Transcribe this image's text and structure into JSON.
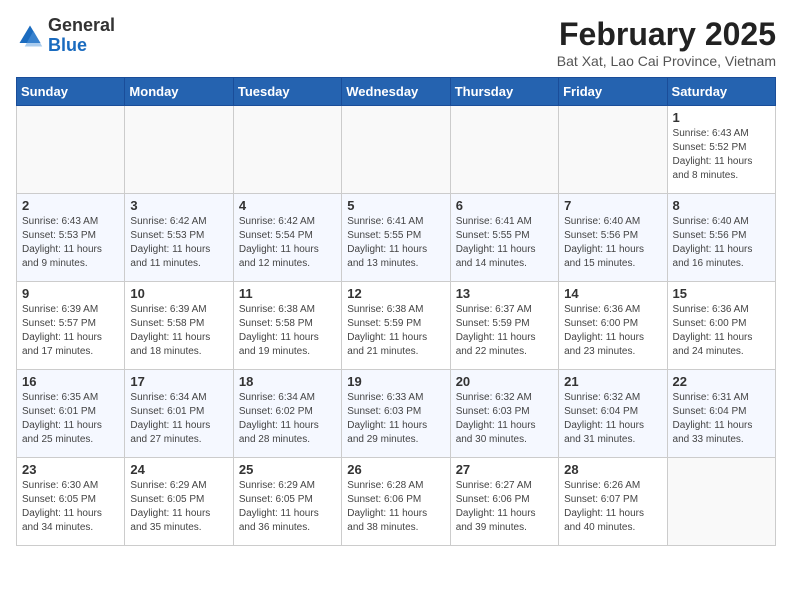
{
  "logo": {
    "general": "General",
    "blue": "Blue"
  },
  "title": "February 2025",
  "subtitle": "Bat Xat, Lao Cai Province, Vietnam",
  "days_of_week": [
    "Sunday",
    "Monday",
    "Tuesday",
    "Wednesday",
    "Thursday",
    "Friday",
    "Saturday"
  ],
  "weeks": [
    [
      {
        "day": null
      },
      {
        "day": null
      },
      {
        "day": null
      },
      {
        "day": null
      },
      {
        "day": null
      },
      {
        "day": null
      },
      {
        "day": "1",
        "info": "Sunrise: 6:43 AM\nSunset: 5:52 PM\nDaylight: 11 hours and 8 minutes."
      }
    ],
    [
      {
        "day": "2",
        "info": "Sunrise: 6:43 AM\nSunset: 5:53 PM\nDaylight: 11 hours and 9 minutes."
      },
      {
        "day": "3",
        "info": "Sunrise: 6:42 AM\nSunset: 5:53 PM\nDaylight: 11 hours and 11 minutes."
      },
      {
        "day": "4",
        "info": "Sunrise: 6:42 AM\nSunset: 5:54 PM\nDaylight: 11 hours and 12 minutes."
      },
      {
        "day": "5",
        "info": "Sunrise: 6:41 AM\nSunset: 5:55 PM\nDaylight: 11 hours and 13 minutes."
      },
      {
        "day": "6",
        "info": "Sunrise: 6:41 AM\nSunset: 5:55 PM\nDaylight: 11 hours and 14 minutes."
      },
      {
        "day": "7",
        "info": "Sunrise: 6:40 AM\nSunset: 5:56 PM\nDaylight: 11 hours and 15 minutes."
      },
      {
        "day": "8",
        "info": "Sunrise: 6:40 AM\nSunset: 5:56 PM\nDaylight: 11 hours and 16 minutes."
      }
    ],
    [
      {
        "day": "9",
        "info": "Sunrise: 6:39 AM\nSunset: 5:57 PM\nDaylight: 11 hours and 17 minutes."
      },
      {
        "day": "10",
        "info": "Sunrise: 6:39 AM\nSunset: 5:58 PM\nDaylight: 11 hours and 18 minutes."
      },
      {
        "day": "11",
        "info": "Sunrise: 6:38 AM\nSunset: 5:58 PM\nDaylight: 11 hours and 19 minutes."
      },
      {
        "day": "12",
        "info": "Sunrise: 6:38 AM\nSunset: 5:59 PM\nDaylight: 11 hours and 21 minutes."
      },
      {
        "day": "13",
        "info": "Sunrise: 6:37 AM\nSunset: 5:59 PM\nDaylight: 11 hours and 22 minutes."
      },
      {
        "day": "14",
        "info": "Sunrise: 6:36 AM\nSunset: 6:00 PM\nDaylight: 11 hours and 23 minutes."
      },
      {
        "day": "15",
        "info": "Sunrise: 6:36 AM\nSunset: 6:00 PM\nDaylight: 11 hours and 24 minutes."
      }
    ],
    [
      {
        "day": "16",
        "info": "Sunrise: 6:35 AM\nSunset: 6:01 PM\nDaylight: 11 hours and 25 minutes."
      },
      {
        "day": "17",
        "info": "Sunrise: 6:34 AM\nSunset: 6:01 PM\nDaylight: 11 hours and 27 minutes."
      },
      {
        "day": "18",
        "info": "Sunrise: 6:34 AM\nSunset: 6:02 PM\nDaylight: 11 hours and 28 minutes."
      },
      {
        "day": "19",
        "info": "Sunrise: 6:33 AM\nSunset: 6:03 PM\nDaylight: 11 hours and 29 minutes."
      },
      {
        "day": "20",
        "info": "Sunrise: 6:32 AM\nSunset: 6:03 PM\nDaylight: 11 hours and 30 minutes."
      },
      {
        "day": "21",
        "info": "Sunrise: 6:32 AM\nSunset: 6:04 PM\nDaylight: 11 hours and 31 minutes."
      },
      {
        "day": "22",
        "info": "Sunrise: 6:31 AM\nSunset: 6:04 PM\nDaylight: 11 hours and 33 minutes."
      }
    ],
    [
      {
        "day": "23",
        "info": "Sunrise: 6:30 AM\nSunset: 6:05 PM\nDaylight: 11 hours and 34 minutes."
      },
      {
        "day": "24",
        "info": "Sunrise: 6:29 AM\nSunset: 6:05 PM\nDaylight: 11 hours and 35 minutes."
      },
      {
        "day": "25",
        "info": "Sunrise: 6:29 AM\nSunset: 6:05 PM\nDaylight: 11 hours and 36 minutes."
      },
      {
        "day": "26",
        "info": "Sunrise: 6:28 AM\nSunset: 6:06 PM\nDaylight: 11 hours and 38 minutes."
      },
      {
        "day": "27",
        "info": "Sunrise: 6:27 AM\nSunset: 6:06 PM\nDaylight: 11 hours and 39 minutes."
      },
      {
        "day": "28",
        "info": "Sunrise: 6:26 AM\nSunset: 6:07 PM\nDaylight: 11 hours and 40 minutes."
      },
      {
        "day": null
      }
    ]
  ]
}
